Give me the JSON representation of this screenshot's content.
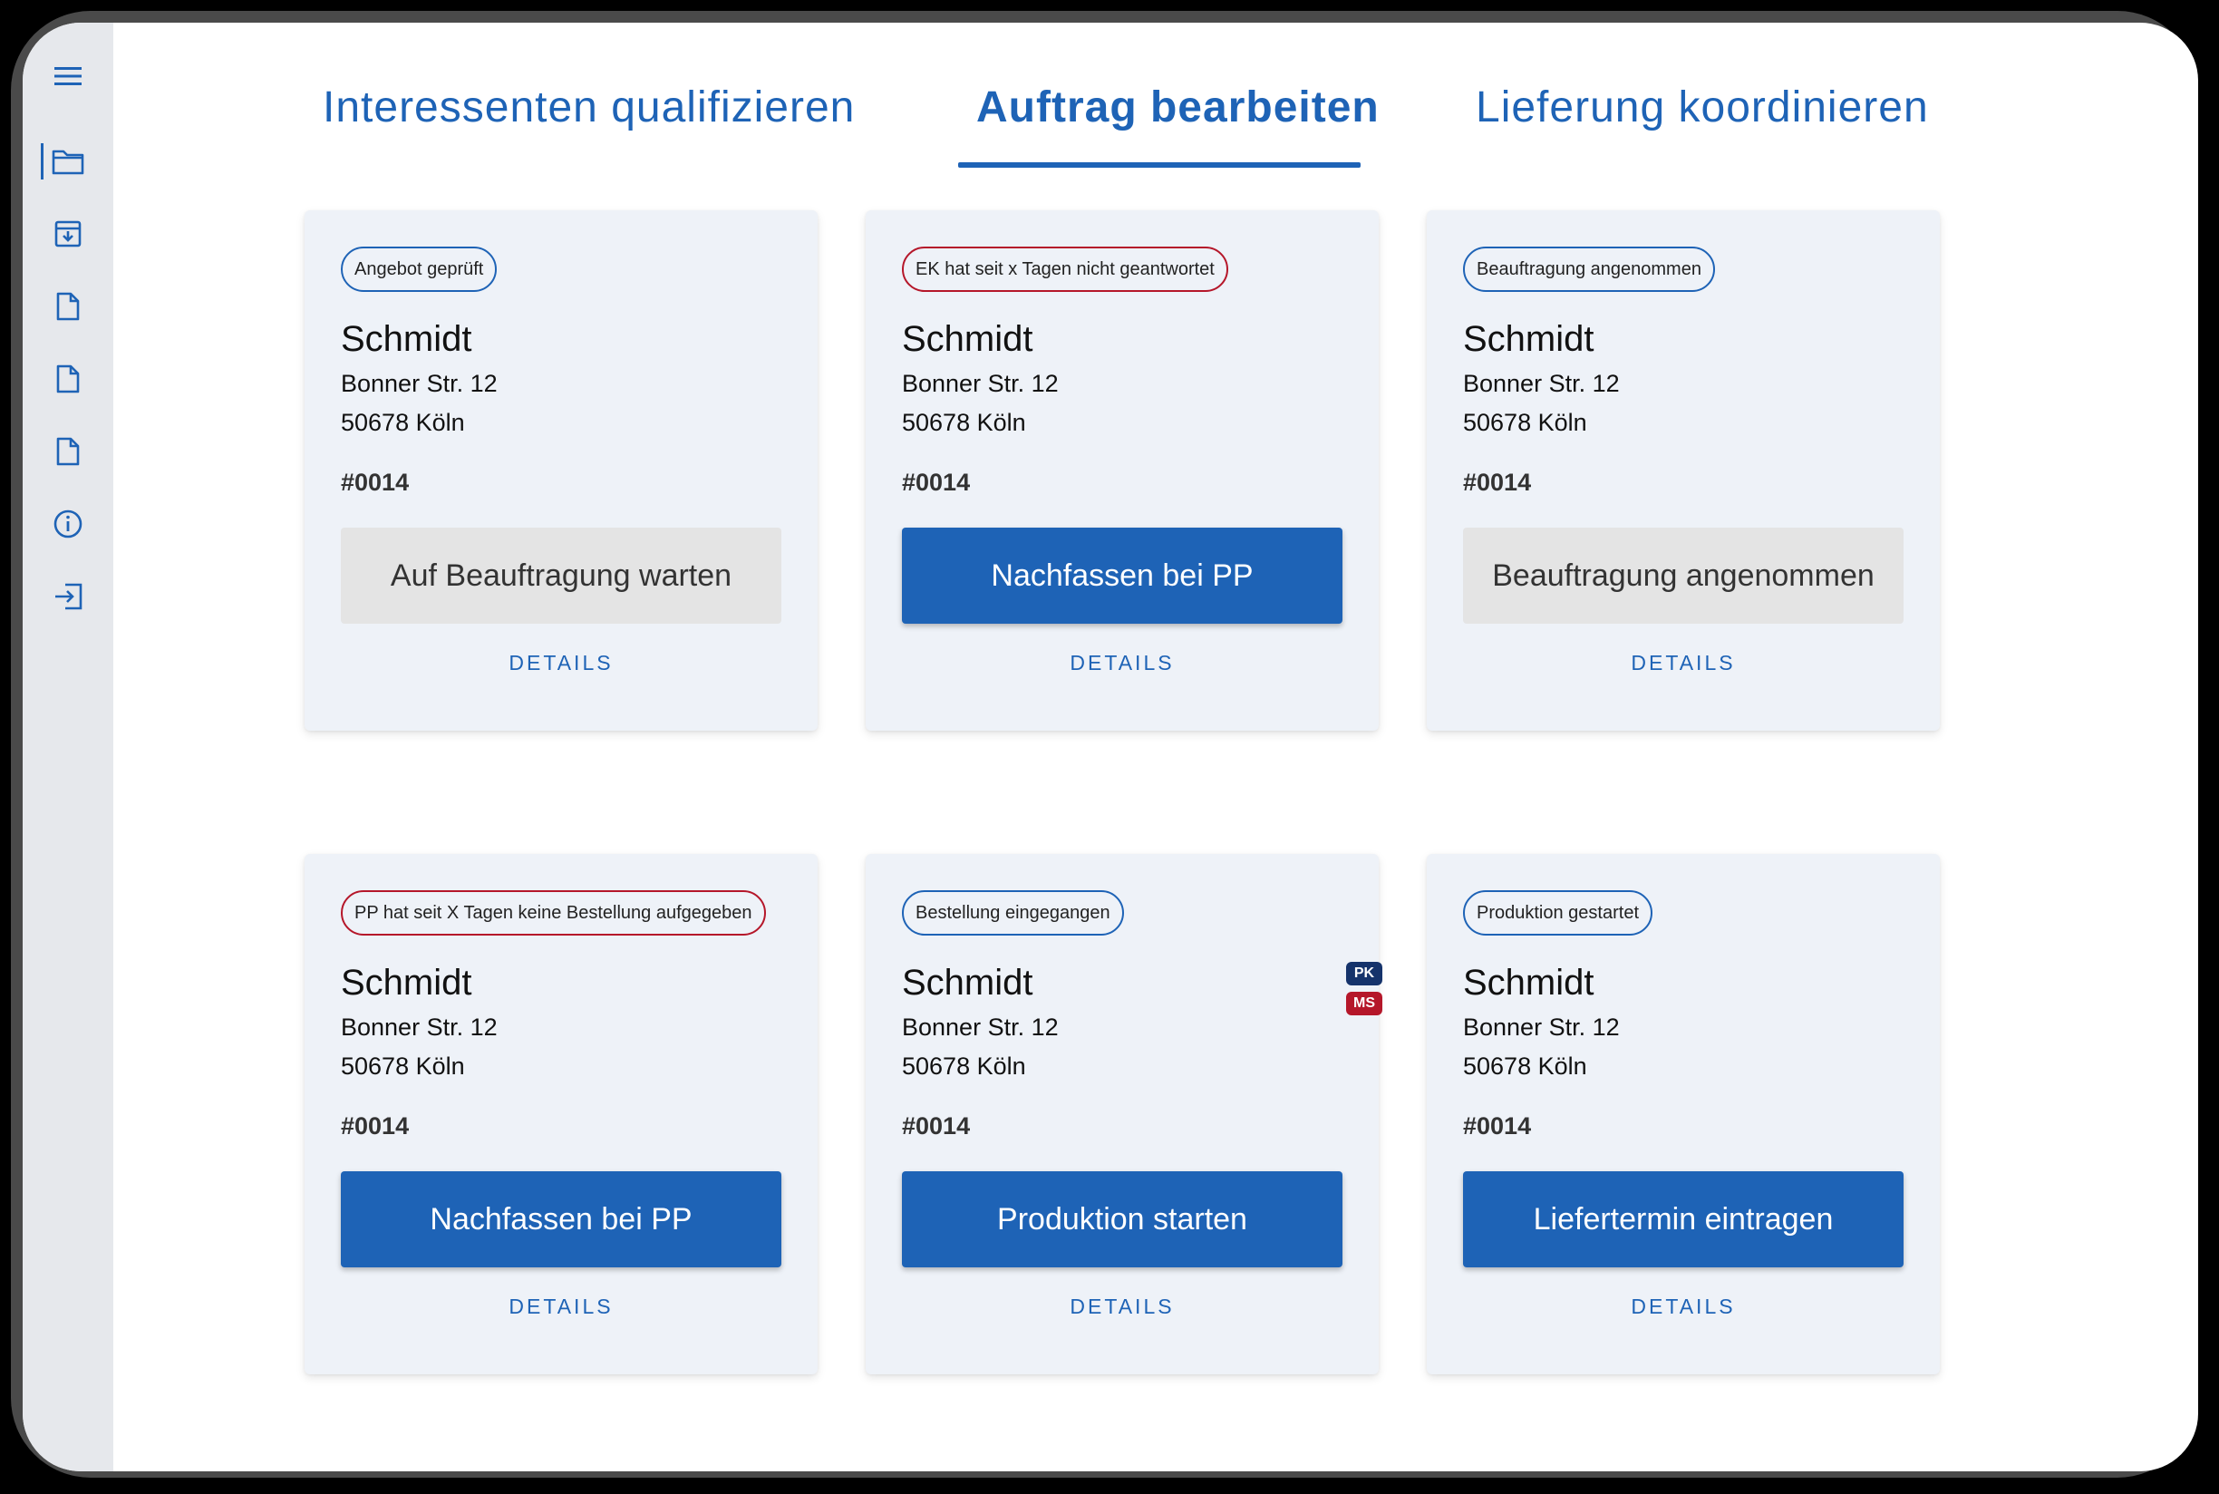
{
  "tabs": [
    {
      "label": "Interessenten qualifizieren",
      "active": false
    },
    {
      "label": "Auftrag bearbeiten",
      "active": true
    },
    {
      "label": "Lieferung koordinieren",
      "active": false
    }
  ],
  "sidebar": {
    "icons": [
      "menu-icon",
      "folder-icon",
      "archive-icon",
      "document-icon",
      "document-icon",
      "document-icon",
      "info-icon",
      "logout-icon"
    ],
    "active": "folder-icon"
  },
  "cards": [
    {
      "status": "Angebot geprüft",
      "status_alert": false,
      "name": "Schmidt",
      "street": "Bonner Str. 12",
      "city": "50678 Köln",
      "order": "#0014",
      "action": "Auf Beauftragung warten",
      "action_enabled": false,
      "details": "DETAILS"
    },
    {
      "status": "EK hat seit x Tagen nicht geantwortet",
      "status_alert": true,
      "name": "Schmidt",
      "street": "Bonner Str. 12",
      "city": "50678 Köln",
      "order": "#0014",
      "action": "Nachfassen bei PP",
      "action_enabled": true,
      "details": "DETAILS"
    },
    {
      "status": "Beauftragung angenommen",
      "status_alert": false,
      "name": "Schmidt",
      "street": "Bonner Str. 12",
      "city": "50678 Köln",
      "order": "#0014",
      "action": "Beauftragung angenommen",
      "action_enabled": false,
      "details": "DETAILS"
    },
    {
      "status": "PP hat seit X Tagen keine Bestellung aufgegeben",
      "status_alert": true,
      "name": "Schmidt",
      "street": "Bonner Str. 12",
      "city": "50678 Köln",
      "order": "#0014",
      "action": "Nachfassen bei PP",
      "action_enabled": true,
      "details": "DETAILS"
    },
    {
      "status": "Bestellung eingegangen",
      "status_alert": false,
      "name": "Schmidt",
      "street": "Bonner Str. 12",
      "city": "50678 Köln",
      "order": "#0014",
      "action": "Produktion starten",
      "action_enabled": true,
      "details": "DETAILS",
      "badges": [
        {
          "text": "PK",
          "color": "#15336b"
        },
        {
          "text": "MS",
          "color": "#b5172a"
        }
      ]
    },
    {
      "status": "Produktion gestartet",
      "status_alert": false,
      "name": "Schmidt",
      "street": "Bonner Str. 12",
      "city": "50678 Köln",
      "order": "#0014",
      "action": "Liefertermin eintragen",
      "action_enabled": true,
      "details": "DETAILS"
    }
  ],
  "colors": {
    "primary": "#1e63b6",
    "alert": "#b5172a",
    "card_bg": "#eef2f8",
    "disabled_bg": "#e4e4e4"
  }
}
